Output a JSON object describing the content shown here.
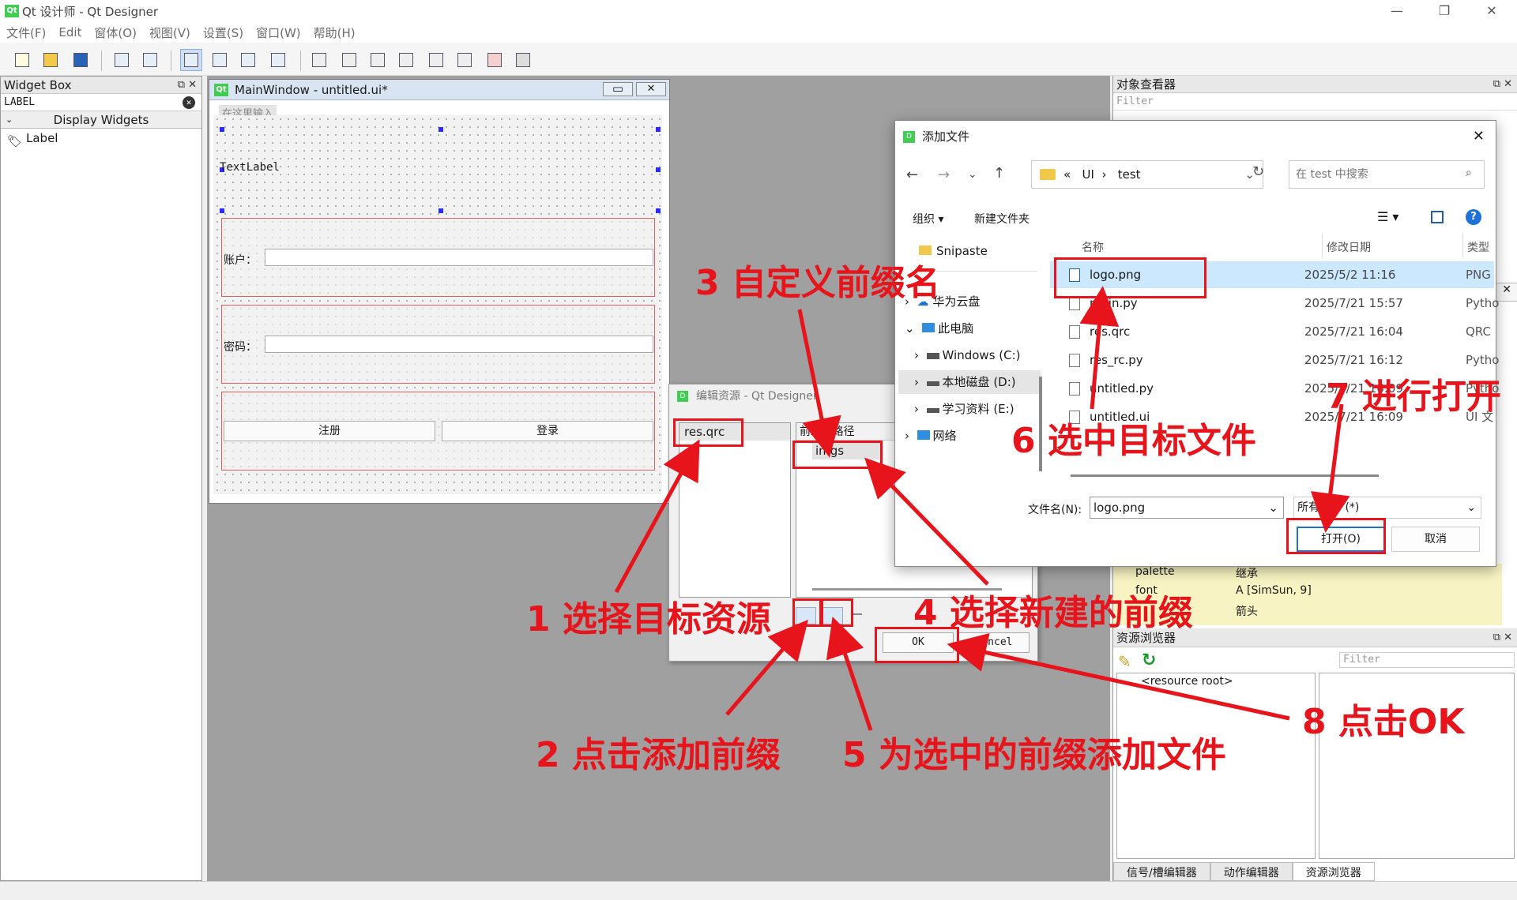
{
  "app": {
    "title": "Qt 设计师 - Qt Designer"
  },
  "menu": [
    "文件(F)",
    "Edit",
    "窗体(O)",
    "视图(V)",
    "设置(S)",
    "窗口(W)",
    "帮助(H)"
  ],
  "widget_box": {
    "title": "Widget Box",
    "filter_value": "LABEL",
    "category": "Display Widgets",
    "item": "Label"
  },
  "main_window": {
    "title": "MainWindow - untitled.ui*",
    "menu_placeholder": "在这里输入",
    "text_label": "TextLabel",
    "account_label": "账户：",
    "password_label": "密码：",
    "register_btn": "注册",
    "login_btn": "登录"
  },
  "object_inspector": {
    "title": "对象查看器",
    "filter": "Filter",
    "props": [
      {
        "name": "palette",
        "value": "继承"
      },
      {
        "name": "font",
        "value": "A  [SimSun, 9]"
      },
      {
        "name": "",
        "value": "箭头"
      }
    ]
  },
  "resource_browser": {
    "title": "资源浏览器",
    "filter": "Filter",
    "root": "<resource root>",
    "tabs": [
      "信号/槽编辑器",
      "动作编辑器",
      "资源浏览器"
    ]
  },
  "edit_resources": {
    "title": "编辑资源 - Qt Designer",
    "qrc_item": "res.qrc",
    "col_prefix": "前缀",
    "col_path": "路径",
    "prefix_item": "imgs",
    "ok": "OK",
    "cancel": "Cancel"
  },
  "add_file": {
    "title": "添加文件",
    "crumb_sep": "«",
    "crumb1": "UI",
    "crumb2": "test",
    "search_placeholder": "在 test 中搜索",
    "organize": "组织 ▾",
    "new_folder": "新建文件夹",
    "col_name": "名称",
    "col_date": "修改日期",
    "col_type": "类型",
    "nav": [
      "Snipaste",
      "华为云盘",
      "此电脑",
      "Windows (C:)",
      "本地磁盘 (D:)",
      "学习资料 (E:)",
      "网络"
    ],
    "files": [
      {
        "name": "logo.png",
        "date": "2025/5/2 11:16",
        "type": "PNG"
      },
      {
        "name": "main.py",
        "date": "2025/7/21 15:57",
        "type": "Pytho"
      },
      {
        "name": "res.qrc",
        "date": "2025/7/21 16:04",
        "type": "QRC"
      },
      {
        "name": "res_rc.py",
        "date": "2025/7/21 16:12",
        "type": "Pytho"
      },
      {
        "name": "untitled.py",
        "date": "2025/7/21 16:09",
        "type": "Pytho"
      },
      {
        "name": "untitled.ui",
        "date": "2025/7/21 16:09",
        "type": "UI 文"
      }
    ],
    "filename_label": "文件名(N):",
    "filename_value": "logo.png",
    "filter_value": "所有文件 (*)",
    "open": "打开(O)",
    "cancel": "取消"
  },
  "annotations": [
    "1 选择目标资源",
    "2 点击添加前缀",
    "3 自定义前缀名",
    "4 选择新建的前缀",
    "5 为选中的前缀添加文件",
    "6 选中目标文件",
    "7 进行打开",
    "8 点击OK"
  ],
  "colors": {
    "annotation": "#e8141b",
    "selection": "#cce8ff",
    "qt_green": "#41cd52"
  }
}
